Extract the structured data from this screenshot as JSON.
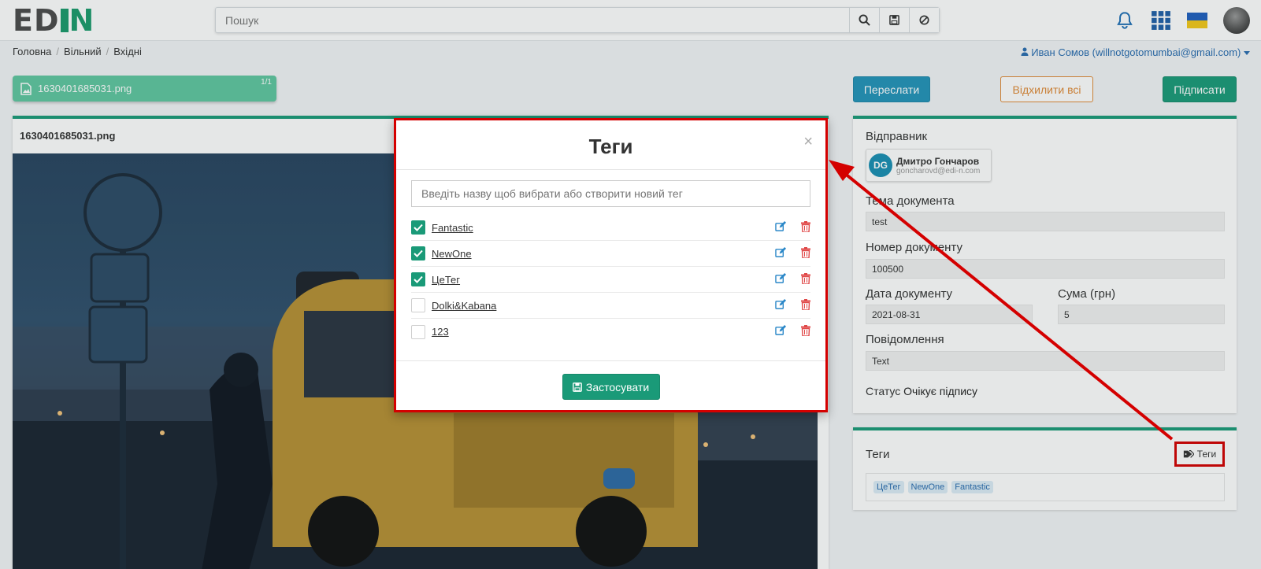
{
  "header": {
    "logo_left": "ED",
    "logo_right": "N",
    "search_placeholder": "Пошук"
  },
  "breadcrumb": {
    "items": [
      "Головна",
      "Вільний",
      "Вхідні"
    ]
  },
  "user": {
    "label": "Иван Сомов (willnotgotomumbai@gmail.com)"
  },
  "file": {
    "name": "1630401685031.png",
    "count": "1/1"
  },
  "actions": {
    "forward": "Переслати",
    "reject_all": "Відхилити всі",
    "sign": "Підписати"
  },
  "viewer": {
    "title": "1630401685031.png"
  },
  "sender_panel": {
    "sender_label": "Відправник",
    "sender_initials": "DG",
    "sender_name": "Дмитро Гончаров",
    "sender_email": "goncharovd@edi-n.com",
    "subject_label": "Тема документа",
    "subject_value": "test",
    "number_label": "Номер документу",
    "number_value": "100500",
    "date_label": "Дата документу",
    "date_value": "2021-08-31",
    "sum_label": "Сума (грн)",
    "sum_value": "5",
    "message_label": "Повідомлення",
    "message_value": "Text",
    "status_label": "Статус",
    "status_value": "Очікує підпису"
  },
  "tags_panel": {
    "label": "Теги",
    "button_label": "Теги",
    "tags": [
      "ЦеТег",
      "NewOne",
      "Fantastic"
    ]
  },
  "modal": {
    "title": "Теги",
    "close": "×",
    "input_placeholder": "Введіть назву щоб вибрати або створити новий тег",
    "tags": [
      {
        "name": "Fantastic",
        "checked": true
      },
      {
        "name": "NewOne",
        "checked": true
      },
      {
        "name": "ЦеТег",
        "checked": true
      },
      {
        "name": "Dolki&Kabana",
        "checked": false
      },
      {
        "name": "123",
        "checked": false
      }
    ],
    "apply_label": "Застосувати"
  },
  "colors": {
    "accent": "#1a9a78",
    "primary": "#2393b9",
    "warning": "#e08a37",
    "danger": "#d40000",
    "link": "#2a6db0"
  }
}
